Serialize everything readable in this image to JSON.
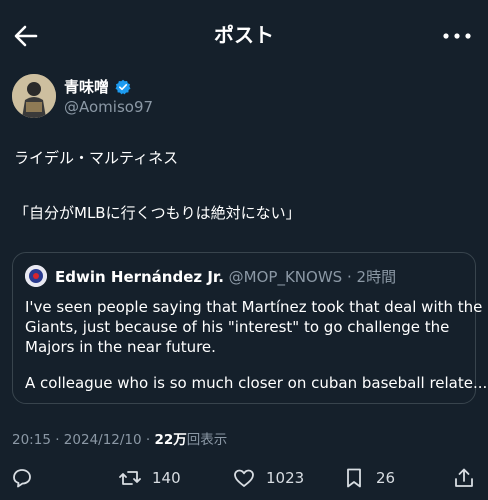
{
  "header": {
    "title": "ポスト"
  },
  "tweet": {
    "author_name": "青味噌",
    "author_handle": "@Aomiso97",
    "lines": [
      "ライデル・マルティネス",
      "「自分がMLBに行くつもりは絶対にない」"
    ]
  },
  "quote": {
    "name": "Edwin Hernández Jr.",
    "handle": "@MOP_KNOWS",
    "separator": "·",
    "time": "2時間",
    "lines": [
      "I've seen people saying that Martínez took that deal with the",
      "Giants, just because of his \"interest\" to go challenge the",
      "Majors in the near future.",
      "A colleague who is so much closer on cuban baseball relate..."
    ]
  },
  "meta": {
    "time": "20:15",
    "separator": "·",
    "date": "2024/12/10",
    "views_count": "22万",
    "views_label": "回表示"
  },
  "actions": {
    "retweets": "140",
    "likes": "1023",
    "bookmarks": "26"
  },
  "icons": [
    "back-arrow-icon",
    "more-icon",
    "verified-icon",
    "reply-icon",
    "retweet-icon",
    "like-icon",
    "bookmark-icon",
    "share-icon"
  ],
  "colors": {
    "background": "#15202b",
    "verified": "#1d9bf0",
    "secondary_text": "#8b98a5",
    "border": "#38444d"
  }
}
